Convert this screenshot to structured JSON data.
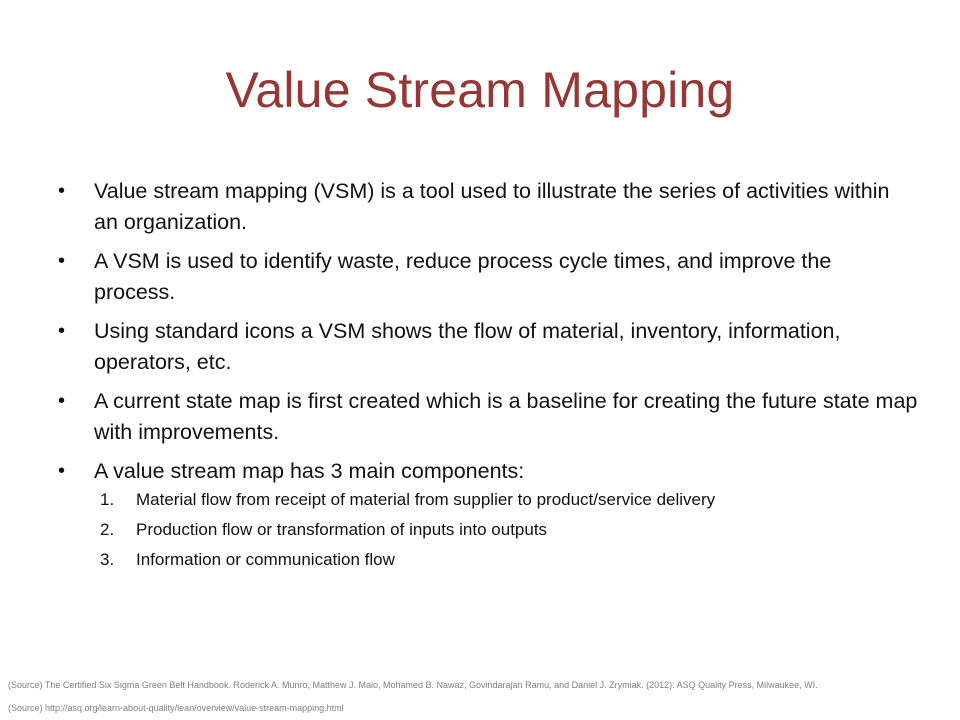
{
  "slide": {
    "title": "Value Stream Mapping",
    "bullets": [
      "Value stream mapping (VSM) is a tool used to illustrate the series of activities within an organization.",
      "A VSM is used to identify waste, reduce process cycle times, and improve the process.",
      "Using standard icons a VSM shows the flow of material, inventory, information, operators, etc.",
      "A current state map is first created which is a baseline for creating the future state map with improvements.",
      "A value stream map has 3 main components:"
    ],
    "bullet_symbol": "•",
    "components": [
      {
        "number": "1.",
        "text": "Material flow from receipt of material from supplier to product/service delivery"
      },
      {
        "number": "2.",
        "text": "Production flow or transformation of inputs into outputs"
      },
      {
        "number": "3.",
        "text": "Information or communication flow"
      }
    ],
    "sources": [
      "(Source) The Certified Six Sigma Green Belt Handbook. Roderick A. Munro, Matthew J. Maio, Mohamed B. Nawaz, Govindarajan Ramu, and Daniel J. Zrymiak. (2012). ASQ Quality Press,  Milwaukee, WI.",
      "(Source) http://asq.org/learn-about-quality/lean/overview/value-stream-mapping.html"
    ],
    "colors": {
      "title": "#953735",
      "body_text": "#111111",
      "source_text": "#7f7f7f",
      "background": "#ffffff"
    }
  }
}
